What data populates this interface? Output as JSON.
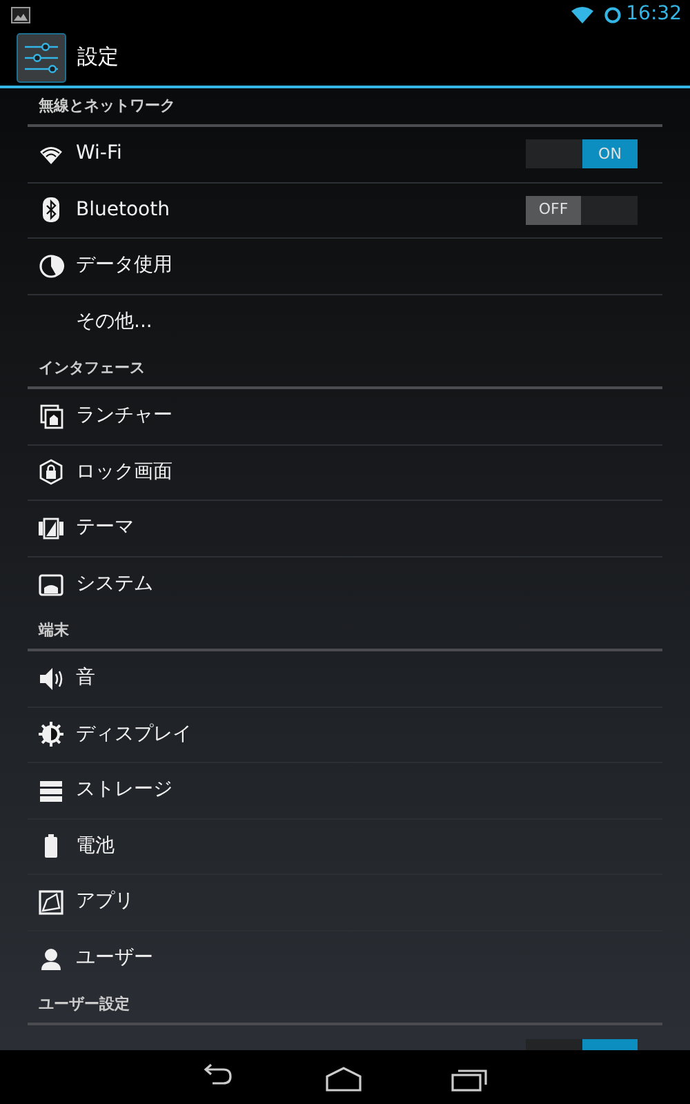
{
  "status_bar": {
    "time": "16:32"
  },
  "action_bar": {
    "title": "設定"
  },
  "sections": [
    {
      "header": "無線とネットワーク",
      "items": [
        {
          "kind": "switch",
          "label": "Wi-Fi",
          "on": true,
          "switch_label": "ON"
        },
        {
          "kind": "switch",
          "label": "Bluetooth",
          "on": false,
          "switch_label": "OFF"
        },
        {
          "kind": "link",
          "label": "データ使用"
        },
        {
          "kind": "link",
          "label": "その他..."
        }
      ]
    },
    {
      "header": "インタフェース",
      "items": [
        {
          "kind": "link",
          "label": "ランチャー"
        },
        {
          "kind": "link",
          "label": "ロック画面"
        },
        {
          "kind": "link",
          "label": "テーマ"
        },
        {
          "kind": "link",
          "label": "システム"
        }
      ]
    },
    {
      "header": "端末",
      "items": [
        {
          "kind": "link",
          "label": "音"
        },
        {
          "kind": "link",
          "label": "ディスプレイ"
        },
        {
          "kind": "link",
          "label": "ストレージ"
        },
        {
          "kind": "link",
          "label": "電池"
        },
        {
          "kind": "link",
          "label": "アプリ"
        },
        {
          "kind": "link",
          "label": "ユーザー"
        }
      ]
    },
    {
      "header": "ユーザー設定",
      "items": [
        {
          "kind": "switch",
          "on": true
        }
      ]
    }
  ]
}
